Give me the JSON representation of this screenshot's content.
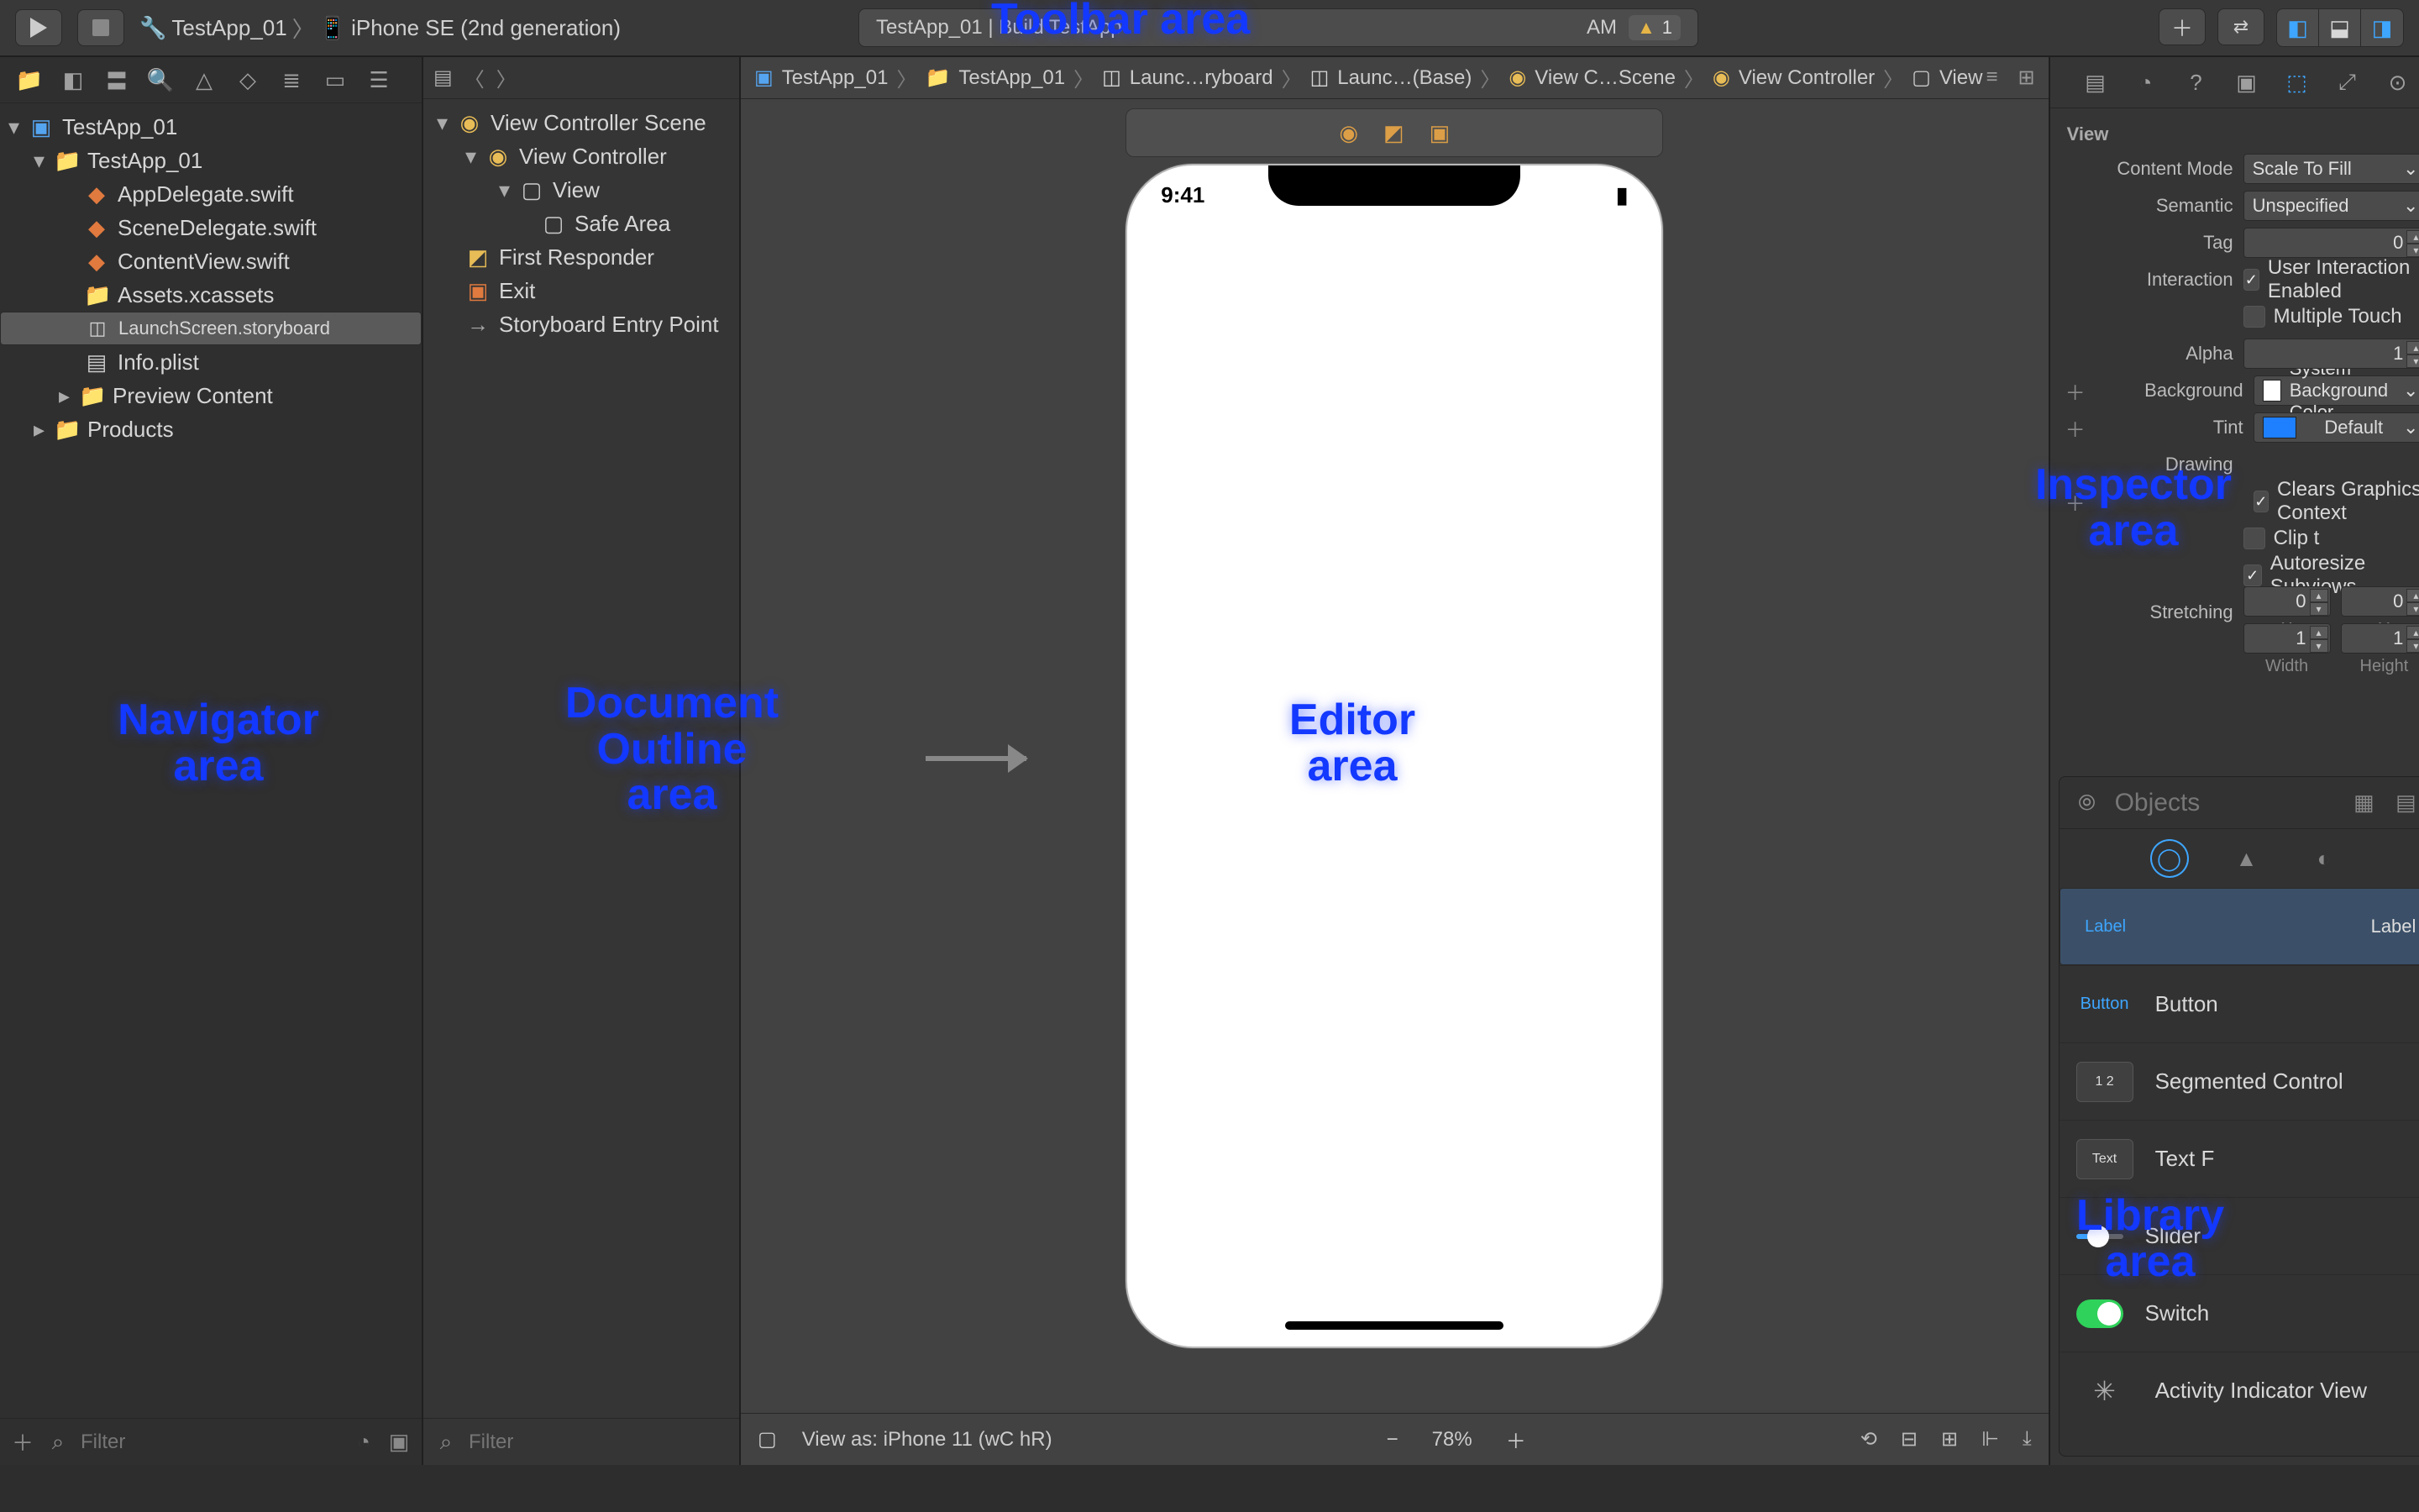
{
  "toolbar": {
    "scheme_app": "TestApp_01",
    "scheme_device": "iPhone SE (2nd generation)",
    "status_left": "TestApp_01 | Build TestApp",
    "status_right": "AM",
    "warnings": "1"
  },
  "breadcrumb": {
    "items": [
      "TestApp_01",
      "TestApp_01",
      "Launc…ryboard",
      "Launc…(Base)",
      "View C…Scene",
      "View Controller",
      "View"
    ]
  },
  "navigator": {
    "root": "TestApp_01",
    "folder": "TestApp_01",
    "files": {
      "appdelegate": "AppDelegate.swift",
      "scenedelegate": "SceneDelegate.swift",
      "contentview": "ContentView.swift",
      "assets": "Assets.xcassets",
      "launchscreen": "LaunchScreen.storyboard",
      "infoplist": "Info.plist",
      "preview": "Preview Content",
      "products": "Products"
    },
    "filter_placeholder": "Filter"
  },
  "outline": {
    "scene": "View Controller Scene",
    "vc": "View Controller",
    "view": "View",
    "safearea": "Safe Area",
    "firstresponder": "First Responder",
    "exit": "Exit",
    "entrypoint": "Storyboard Entry Point",
    "filter_placeholder": "Filter"
  },
  "device": {
    "time": "9:41"
  },
  "canvas_footer": {
    "viewas": "View as: iPhone 11 (wC hR)",
    "zoom": "78%"
  },
  "inspector": {
    "section": "View",
    "content_mode_label": "Content Mode",
    "content_mode_value": "Scale To Fill",
    "semantic_label": "Semantic",
    "semantic_value": "Unspecified",
    "tag_label": "Tag",
    "tag_value": "0",
    "interaction_label": "Interaction",
    "user_interaction": "User Interaction Enabled",
    "multiple_touch": "Multiple Touch",
    "alpha_label": "Alpha",
    "alpha_value": "1",
    "background_label": "Background",
    "background_value": "System Background Color",
    "tint_label": "Tint",
    "tint_value": "Default",
    "drawing_label": "Drawing",
    "clears_graphics": "Clears Graphics Context",
    "clip": "Clip t",
    "autoresize": "Autoresize Subviews",
    "stretching_label": "Stretching",
    "stretch_x": "0",
    "stretch_y": "0",
    "stretch_w": "1",
    "stretch_h": "1",
    "axis_x": "X",
    "axis_y": "Y",
    "axis_w": "Width",
    "axis_h": "Height",
    "background_swatch": "#ffffff",
    "tint_swatch": "#1e7fff"
  },
  "library": {
    "search_placeholder": "Objects",
    "items": {
      "label_thumb": "Label",
      "label": "Label",
      "button_thumb": "Button",
      "button": "Button",
      "segmented_thumb": "1  2",
      "segmented": "Segmented Control",
      "textfield_thumb": "Text",
      "textfield": "Text F",
      "slider": "Slider",
      "switch": "Switch",
      "activity": "Activity Indicator View"
    }
  },
  "annotations": {
    "toolbar": "Toolbar area",
    "navigator": "Navigator\narea",
    "outline": "Document\nOutline\narea",
    "editor": "Editor\narea",
    "inspector": "Inspector\narea",
    "library": "Library\narea"
  }
}
